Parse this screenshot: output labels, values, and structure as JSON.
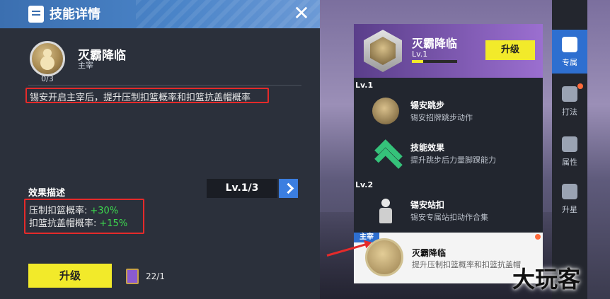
{
  "left_panel": {
    "title": "技能详情",
    "close_icon": "close-icon",
    "skill": {
      "name": "灭霸降临",
      "type": "主宰",
      "progress": "0/3",
      "description": "锡安开启主宰后，提升压制扣篮概率和扣篮抗盖帽概率"
    },
    "effect": {
      "title": "效果描述",
      "level_text": "Lv.1/3",
      "rows": [
        {
          "label": "压制扣篮概率:",
          "value": "+30%"
        },
        {
          "label": "扣篮抗盖帽概率:",
          "value": "+15%"
        }
      ]
    },
    "upgrade_label": "升级",
    "card_count": "22/1"
  },
  "skill_list": {
    "header": {
      "name": "灭霸降临",
      "level": "Lv.1",
      "level_progress": 0.25,
      "upgrade_label": "升级"
    },
    "groups": [
      {
        "label": "Lv.1",
        "items": [
          {
            "name": "锡安跳步",
            "desc": "锡安招牌跳步动作",
            "icon": "player-crouch-icon"
          },
          {
            "name": "技能效果",
            "desc": "提升跳步后力量脚踝能力",
            "icon": "chevron-up-icon"
          }
        ]
      },
      {
        "label": "Lv.2",
        "items": [
          {
            "name": "锡安站扣",
            "desc": "锡安专属站扣动作合集",
            "icon": "player-dunk-icon"
          }
        ]
      }
    ],
    "selected": {
      "tag": "主宰",
      "name": "灭霸降临",
      "desc": "提升压制扣篮概率和扣篮抗盖帽"
    }
  },
  "side_tabs": [
    {
      "label": "专属",
      "icon": "exclusive-icon",
      "active": true
    },
    {
      "label": "打法",
      "icon": "playstyle-icon",
      "active": false,
      "dot": true
    },
    {
      "label": "属性",
      "icon": "attribute-icon",
      "active": false
    },
    {
      "label": "升星",
      "icon": "star-icon",
      "active": false
    }
  ],
  "watermark": "大玩客",
  "colors": {
    "accent_yellow": "#f2ea2a",
    "accent_blue": "#2e6fd0",
    "highlight_red": "#e52a2a",
    "positive_green": "#3ddc4f"
  }
}
